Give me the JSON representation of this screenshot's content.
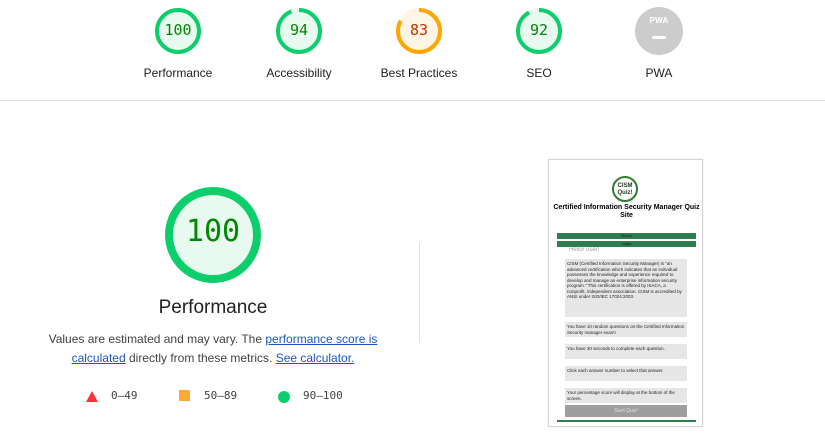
{
  "categories": [
    {
      "label": "Performance",
      "score": "100",
      "fraction": 1.0,
      "color": "#0cce6b",
      "bg": "#e8f9ef"
    },
    {
      "label": "Accessibility",
      "score": "94",
      "fraction": 0.94,
      "color": "#0cce6b",
      "bg": "#e8f9ef"
    },
    {
      "label": "Best Practices",
      "score": "83",
      "fraction": 0.83,
      "color": "#ffa400",
      "bg": "#fff5e5"
    },
    {
      "label": "SEO",
      "score": "92",
      "fraction": 0.92,
      "color": "#0cce6b",
      "bg": "#e8f9ef"
    },
    {
      "label": "PWA",
      "score": "PWA",
      "fraction": 0,
      "color": "#cccccc",
      "bg": "#cccccc"
    }
  ],
  "main": {
    "score": "100",
    "title": "Performance",
    "desc_before": "Values are estimated and may vary. The ",
    "desc_link1": "performance score is calculated",
    "desc_middle": " directly from these metrics. ",
    "desc_link2": "See calculator."
  },
  "legend": {
    "fail": "0–49",
    "average": "50–89",
    "pass": "90–100"
  },
  "thumbnail": {
    "logo_line1": "CISM",
    "logo_line2": "Quiz!",
    "title": "Certified Information Security Manager Quiz Site",
    "nav1": "Home",
    "nav2": "Login",
    "hello": "Hello! user!",
    "box1": "CISM (Certified Information Security Manager) is \"an advanced certification which indicates that an individual possesses the knowledge and experience required to develop and manage an enterprise information security program.\" This certification is offered by ISACA, a nonprofit, independent association. CISM is accredited by ANSI under ISO/IEC 17024:2003.",
    "box2": "You have 10 random questions on the Certified Information Security manager exam!",
    "box3": "You have 30 seconds to complete each question.",
    "box4": "Click each answer number to select that answer.",
    "box5": "Your percentage score will display at the bottom of the screen.",
    "start": "Start Quiz!"
  }
}
